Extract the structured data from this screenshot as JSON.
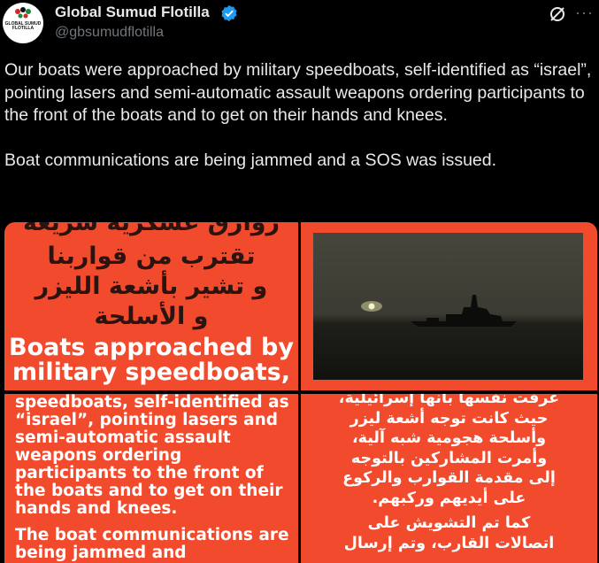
{
  "account": {
    "name": "Global Sumud Flotilla",
    "handle": "@gbsumudflotilla",
    "avatar_text": "GLOBAL SUMUD FLOTILLA",
    "verified_color": "#1d9bf0"
  },
  "icons": {
    "grok": "grok-icon",
    "more": "more-icon",
    "verified": "verified-badge-icon"
  },
  "post": {
    "paragraph_1": "Our boats were approached by military speedboats, self-identified as “israel”, pointing lasers and semi-automatic assault weapons ordering participants to the front of the boats and to get on their hands and knees.",
    "paragraph_2": "Boat communications are being jammed and a SOS was issued."
  },
  "media": {
    "accent_color": "#f24a2c",
    "top_left": {
      "arabic_line_0": "زوارق عسكرية سريعة",
      "arabic_line_1": "تقترب من قواربنا",
      "arabic_line_2": "و تشير بأشعة الليزر",
      "arabic_line_3": "و الأسلحة",
      "english": "Boats approached by military speedboats,"
    },
    "bottom_left": {
      "paragraph_1": "speedboats, self-identified as “israel”, pointing lasers and semi-automatic assault weapons ordering participants to the front of the boats and to get on their hands and knees.",
      "paragraph_2": "The boat communications are being jammed and"
    },
    "bottom_right": {
      "lines": [
        "عرفت نفسها بأنها إسرائيلية،",
        "حيث كانت توجه أشعة ليزر",
        "وأسلحة هجومية شبه آلية،",
        "وأمرت المشاركين بالتوجه",
        "إلى مقدمة القوارب والركوع",
        "على أيديهم وركبهم.",
        "كما تم التشويش على",
        "اتصالات القارب، وتم إرسال"
      ]
    }
  }
}
